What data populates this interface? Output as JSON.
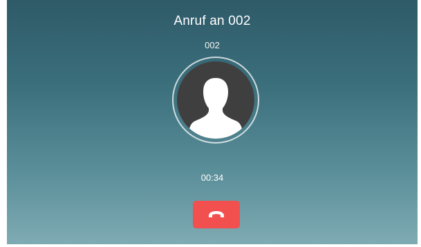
{
  "call": {
    "title": "Anruf an 002",
    "number": "002",
    "duration": "00:34"
  },
  "avatar": {
    "icon": "person-silhouette-icon"
  },
  "hangup": {
    "icon": "phone-hangup-icon",
    "color": "#f24f4f"
  },
  "theme": {
    "background_top": "#2f5a68",
    "background_bottom": "#7fabb3",
    "avatar_background": "#3f3f3f"
  }
}
